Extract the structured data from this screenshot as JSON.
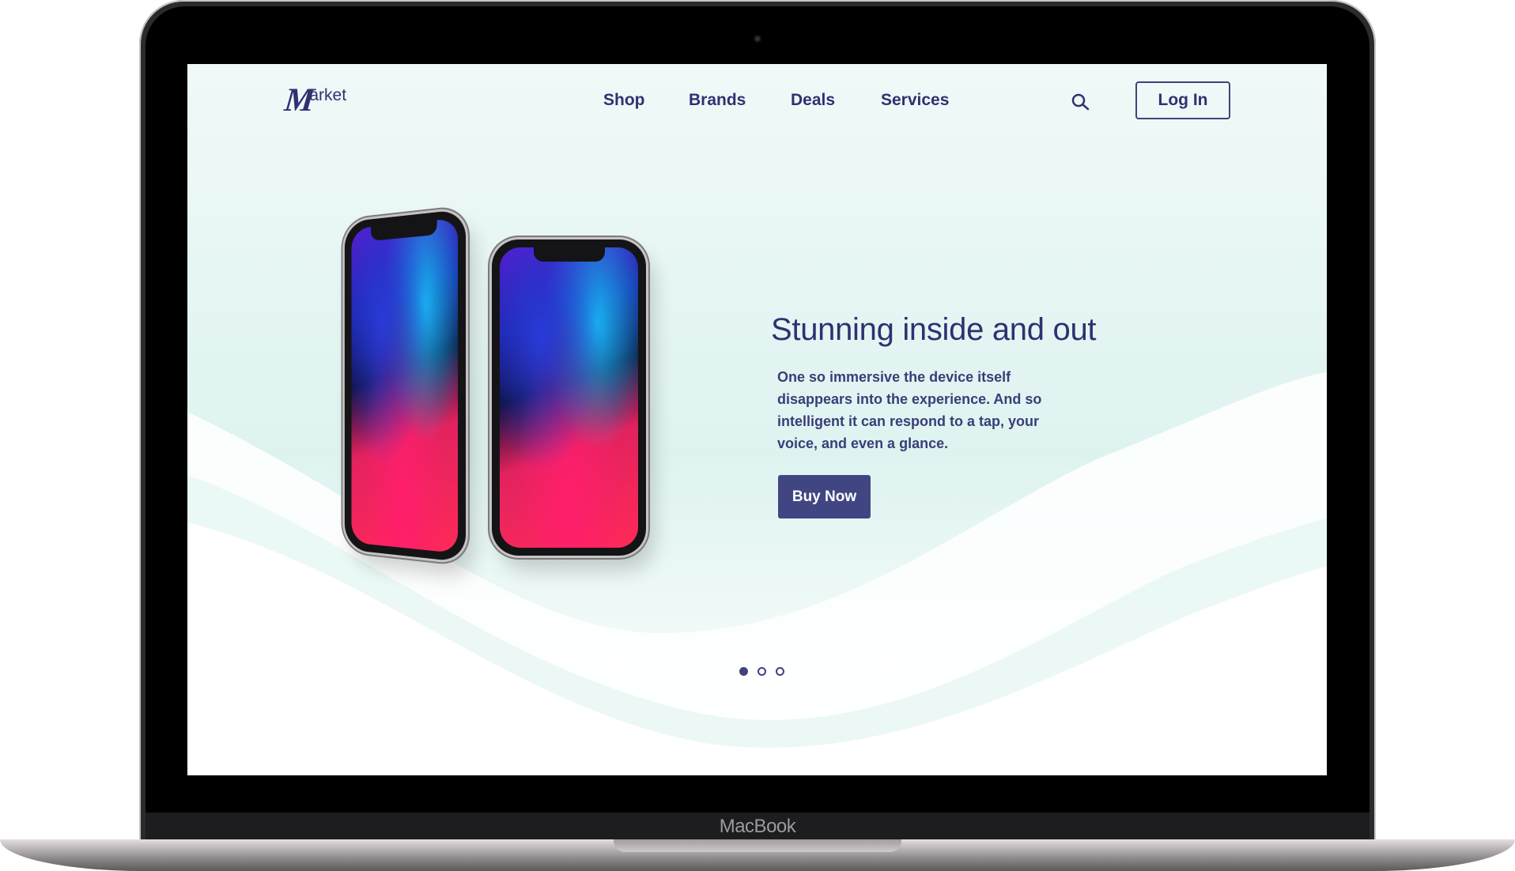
{
  "device": {
    "brand_label": "MacBook"
  },
  "logo": {
    "letter": "M",
    "rest": "arket"
  },
  "nav": {
    "items": [
      "Shop",
      "Brands",
      "Deals",
      "Services"
    ]
  },
  "header": {
    "login_label": "Log In"
  },
  "hero": {
    "headline": "Stunning inside and out",
    "body": "One so immersive the device itself disappears into the experience. And so intelligent it can respond to a tap, your voice, and even a glance.",
    "cta_label": "Buy Now"
  },
  "carousel": {
    "total": 3,
    "active_index": 0
  },
  "colors": {
    "brand": "#2f3170",
    "cta": "#414683",
    "screen_bg": "#e6f6f4"
  }
}
